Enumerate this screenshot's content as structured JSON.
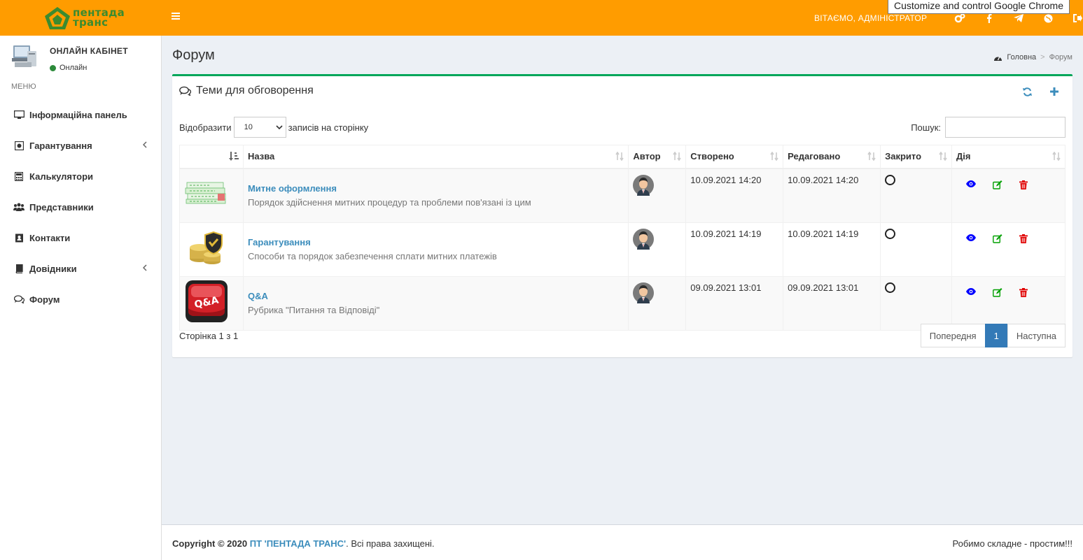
{
  "tooltip": "Customize and control Google Chrome",
  "header": {
    "logo_line1": "пентада",
    "logo_line2": "транс",
    "welcome": "ВІТАЄМО, АДМІНІСТРАТОР",
    "icons": [
      "gears-icon",
      "facebook-icon",
      "telegram-icon",
      "globe-icon",
      "sign-out-icon"
    ]
  },
  "sidebar": {
    "user_name": "ОНЛАЙН КАБІНЕТ",
    "status": "Онлайн",
    "menu_header": "МЕНЮ",
    "items": [
      {
        "label": "Інформаційна панель",
        "icon": "monitor-icon"
      },
      {
        "label": "Гарантування",
        "icon": "shield-icon",
        "has_submenu": true
      },
      {
        "label": "Калькулятори",
        "icon": "calculator-icon"
      },
      {
        "label": "Представники",
        "icon": "users-icon"
      },
      {
        "label": "Контакти",
        "icon": "address-book-icon"
      },
      {
        "label": "Довідники",
        "icon": "book-icon",
        "has_submenu": true
      },
      {
        "label": "Форум",
        "icon": "comments-icon"
      }
    ]
  },
  "page": {
    "title": "Форум",
    "breadcrumb_home": "Головна",
    "breadcrumb_sep": ">",
    "breadcrumb_current": "Форум"
  },
  "box": {
    "title": "Теми для обговорення",
    "show_label": "Відобразити",
    "page_size": "10",
    "per_page_label": "записів на сторінку",
    "search_label": "Пошук:",
    "search_value": "",
    "columns": [
      "",
      "Назва",
      "Автор",
      "Створено",
      "Редаговано",
      "Закрито",
      "Дія"
    ],
    "rows": [
      {
        "image": "customs-documents-image",
        "title": "Митне оформлення",
        "description": "Порядок здійснення митних процедур та проблеми пов'язані із цим",
        "created": "10.09.2021 14:20",
        "edited": "10.09.2021 14:20"
      },
      {
        "image": "guarantee-coins-image",
        "title": "Гарантування",
        "description": "Способи та порядок забезпечення сплати митних платежів",
        "created": "10.09.2021 14:19",
        "edited": "10.09.2021 14:19"
      },
      {
        "image": "qa-button-image",
        "title": "Q&A",
        "description": "Рубрика \"Питання та Відповіді\"",
        "created": "09.09.2021 13:01",
        "edited": "09.09.2021 13:01"
      }
    ],
    "info": "Сторінка 1 з 1",
    "pager": {
      "prev": "Попередня",
      "page": "1",
      "next": "Наступна"
    }
  },
  "footer": {
    "copyright_prefix": "Copyright © 2020 ",
    "brand": "ПТ 'ПЕНТАДА ТРАНС'",
    "rights": ". Всі права захищені.",
    "slogan": "Робимо складне - простим!!!"
  },
  "colors": {
    "header": "#ff9c00",
    "accent": "#3c8dbc",
    "box_border": "#00a65a",
    "view": "#0000ff",
    "edit": "#00a000",
    "delete": "#e00000"
  }
}
